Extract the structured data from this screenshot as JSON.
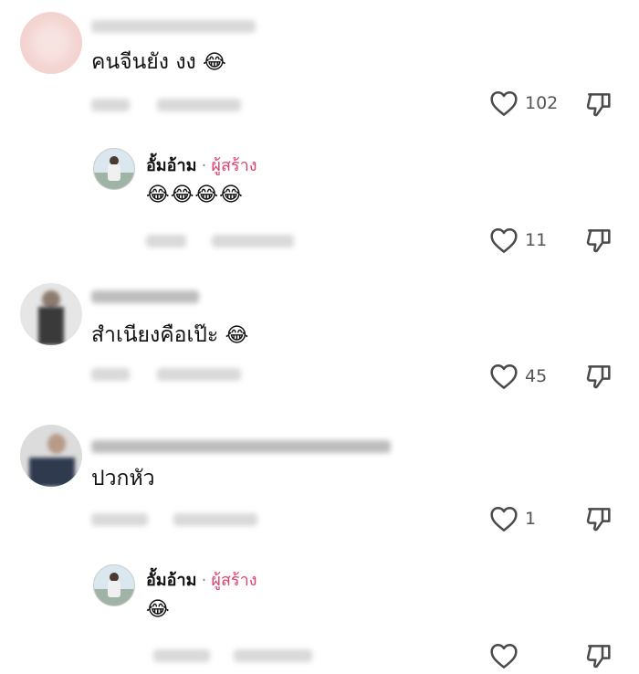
{
  "comments": [
    {
      "text": "คนจีนยัง งง",
      "emoji": "😂",
      "likes": "102"
    },
    {
      "text": "สำเนียงคือเป๊ะ",
      "emoji": "😂",
      "likes": "45"
    },
    {
      "text": "ปวกหัว",
      "emoji": "",
      "likes": "1"
    }
  ],
  "replies": [
    {
      "author": "อั้มอ้าม",
      "separator": "·",
      "badge": "ผู้สร้าง",
      "emoji": "😂😂😂😂",
      "likes": "11"
    },
    {
      "author": "อั้มอ้าม",
      "separator": "·",
      "badge": "ผู้สร้าง",
      "emoji": "😂",
      "likes": ""
    }
  ],
  "colors": {
    "creator_badge": "#e1406b",
    "icon": "#4a4a4a",
    "meta_gray": "#9a9a9a"
  },
  "icons": {
    "like": "heart-outline-icon",
    "dislike": "thumb-down-icon"
  }
}
